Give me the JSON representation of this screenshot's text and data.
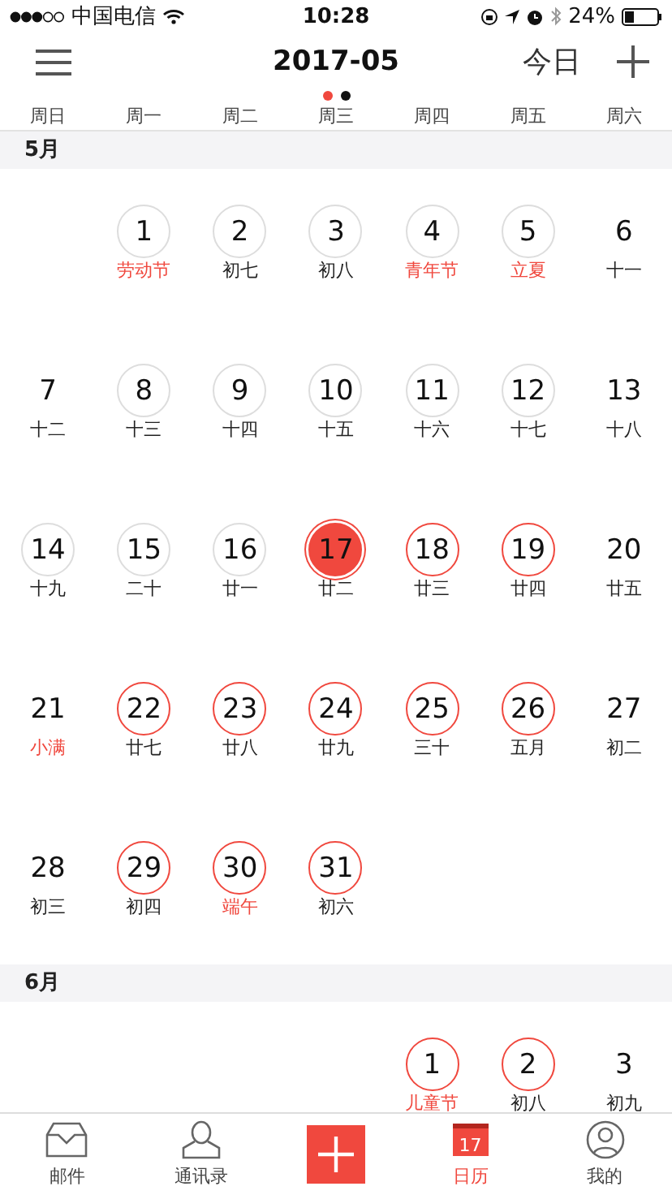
{
  "status_bar": {
    "carrier": "中国电信",
    "time": "10:28",
    "battery": "24%"
  },
  "header": {
    "title": "2017-05",
    "today_button": "今日"
  },
  "page_dots": [
    {
      "selected": true
    },
    {
      "selected": false
    }
  ],
  "weekdays": [
    "周日",
    "周一",
    "周二",
    "周三",
    "周四",
    "周五",
    "周六"
  ],
  "months": [
    {
      "label": "5月",
      "weeks": [
        [
          {
            "kind": "blank"
          },
          {
            "kind": "day",
            "day": "1",
            "lunar": "劳动节",
            "festival": true,
            "circled": true,
            "color": "#dddddd",
            "today": false
          },
          {
            "kind": "day",
            "day": "2",
            "lunar": "初七",
            "festival": false,
            "circled": true,
            "color": "#dddddd",
            "today": false
          },
          {
            "kind": "day",
            "day": "3",
            "lunar": "初八",
            "festival": false,
            "circled": true,
            "color": "#dddddd",
            "today": false
          },
          {
            "kind": "day",
            "day": "4",
            "lunar": "青年节",
            "festival": true,
            "circled": true,
            "color": "#dddddd",
            "today": false
          },
          {
            "kind": "day",
            "day": "5",
            "lunar": "立夏",
            "festival": true,
            "circled": true,
            "color": "#dddddd",
            "today": false
          },
          {
            "kind": "day",
            "day": "6",
            "lunar": "十一",
            "festival": false,
            "circled": false,
            "today": false
          }
        ],
        [
          {
            "kind": "day",
            "day": "7",
            "lunar": "十二",
            "festival": false,
            "circled": false,
            "today": false
          },
          {
            "kind": "day",
            "day": "8",
            "lunar": "十三",
            "festival": false,
            "circled": true,
            "color": "#dddddd",
            "today": false
          },
          {
            "kind": "day",
            "day": "9",
            "lunar": "十四",
            "festival": false,
            "circled": true,
            "color": "#dddddd",
            "today": false
          },
          {
            "kind": "day",
            "day": "10",
            "lunar": "十五",
            "festival": false,
            "circled": true,
            "color": "#dddddd",
            "today": false
          },
          {
            "kind": "day",
            "day": "11",
            "lunar": "十六",
            "festival": false,
            "circled": true,
            "color": "#dddddd",
            "today": false
          },
          {
            "kind": "day",
            "day": "12",
            "lunar": "十七",
            "festival": false,
            "circled": true,
            "color": "#dddddd",
            "today": false
          },
          {
            "kind": "day",
            "day": "13",
            "lunar": "十八",
            "festival": false,
            "circled": false,
            "today": false
          }
        ],
        [
          {
            "kind": "day",
            "day": "14",
            "lunar": "十九",
            "festival": false,
            "circled": true,
            "color": "#dddddd",
            "today": false
          },
          {
            "kind": "day",
            "day": "15",
            "lunar": "二十",
            "festival": false,
            "circled": true,
            "color": "#dddddd",
            "today": false
          },
          {
            "kind": "day",
            "day": "16",
            "lunar": "廿一",
            "festival": false,
            "circled": true,
            "color": "#dddddd",
            "today": false
          },
          {
            "kind": "day",
            "day": "17",
            "lunar": "廿二",
            "festival": false,
            "circled": true,
            "color": "#f0483e",
            "today": true
          },
          {
            "kind": "day",
            "day": "18",
            "lunar": "廿三",
            "festival": false,
            "circled": true,
            "color": "#f0483e",
            "today": false
          },
          {
            "kind": "day",
            "day": "19",
            "lunar": "廿四",
            "festival": false,
            "circled": true,
            "color": "#f0483e",
            "today": false
          },
          {
            "kind": "day",
            "day": "20",
            "lunar": "廿五",
            "festival": false,
            "circled": false,
            "today": false
          }
        ],
        [
          {
            "kind": "day",
            "day": "21",
            "lunar": "小满",
            "festival": true,
            "circled": false,
            "today": false
          },
          {
            "kind": "day",
            "day": "22",
            "lunar": "廿七",
            "festival": false,
            "circled": true,
            "color": "#f0483e",
            "today": false
          },
          {
            "kind": "day",
            "day": "23",
            "lunar": "廿八",
            "festival": false,
            "circled": true,
            "color": "#f0483e",
            "today": false
          },
          {
            "kind": "day",
            "day": "24",
            "lunar": "廿九",
            "festival": false,
            "circled": true,
            "color": "#f0483e",
            "today": false
          },
          {
            "kind": "day",
            "day": "25",
            "lunar": "三十",
            "festival": false,
            "circled": true,
            "color": "#f0483e",
            "today": false
          },
          {
            "kind": "day",
            "day": "26",
            "lunar": "五月",
            "festival": false,
            "circled": true,
            "color": "#f0483e",
            "today": false
          },
          {
            "kind": "day",
            "day": "27",
            "lunar": "初二",
            "festival": false,
            "circled": false,
            "today": false
          }
        ],
        [
          {
            "kind": "day",
            "day": "28",
            "lunar": "初三",
            "festival": false,
            "circled": false,
            "today": false
          },
          {
            "kind": "day",
            "day": "29",
            "lunar": "初四",
            "festival": false,
            "circled": true,
            "color": "#f0483e",
            "today": false
          },
          {
            "kind": "day",
            "day": "30",
            "lunar": "端午",
            "festival": true,
            "circled": true,
            "color": "#f0483e",
            "today": false
          },
          {
            "kind": "day",
            "day": "31",
            "lunar": "初六",
            "festival": false,
            "circled": true,
            "color": "#f0483e",
            "today": false
          },
          {
            "kind": "blank"
          },
          {
            "kind": "blank"
          },
          {
            "kind": "blank"
          }
        ]
      ]
    },
    {
      "label": "6月",
      "weeks": [
        [
          {
            "kind": "blank"
          },
          {
            "kind": "blank"
          },
          {
            "kind": "blank"
          },
          {
            "kind": "blank"
          },
          {
            "kind": "day",
            "day": "1",
            "lunar": "儿童节",
            "festival": true,
            "circled": true,
            "color": "#f0483e",
            "today": false
          },
          {
            "kind": "day",
            "day": "2",
            "lunar": "初八",
            "festival": false,
            "circled": true,
            "color": "#f0483e",
            "today": false
          },
          {
            "kind": "day",
            "day": "3",
            "lunar": "初九",
            "festival": false,
            "circled": false,
            "today": false
          }
        ]
      ]
    }
  ],
  "tab_bar": [
    {
      "kind": "mail",
      "label": "邮件",
      "selected": false
    },
    {
      "kind": "contacts",
      "label": "通讯录",
      "selected": false
    },
    {
      "kind": "add",
      "selected": false
    },
    {
      "kind": "calendar",
      "label": "日历",
      "badge": "17",
      "selected": true
    },
    {
      "kind": "me",
      "label": "我的",
      "selected": false
    }
  ]
}
